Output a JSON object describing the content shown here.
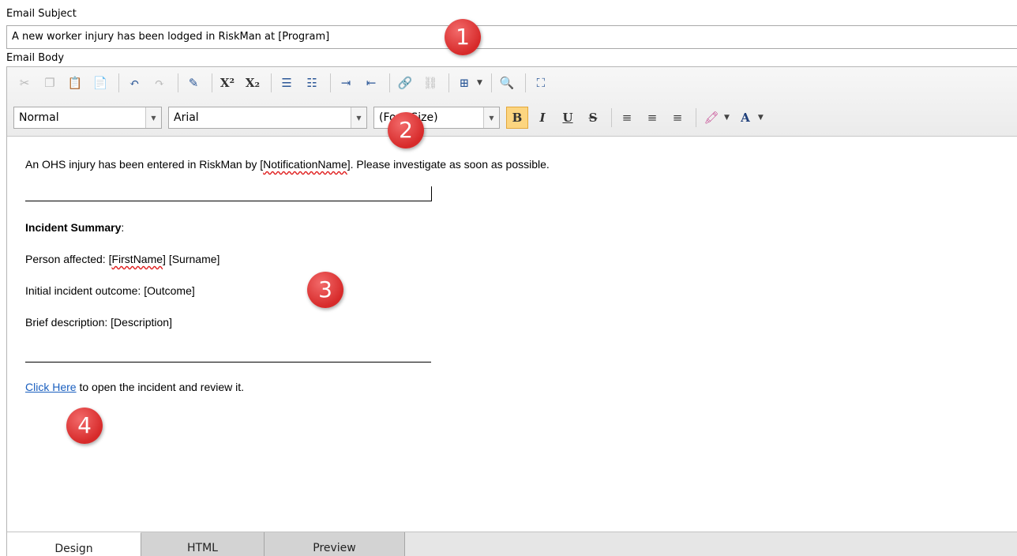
{
  "subject": {
    "label": "Email Subject",
    "value": "A new worker injury has been lodged in RiskMan at [Program]"
  },
  "body": {
    "label": "Email Body"
  },
  "toolbar": {
    "style_value": "Normal",
    "font_value": "Arial",
    "size_value": "(Font Size)",
    "bold_glyph": "B",
    "italic_glyph": "I",
    "underline_glyph": "U",
    "strike_glyph": "S",
    "forecolor_glyph": "A",
    "superscript_glyph": "X²",
    "subscript_glyph": "X₂"
  },
  "content": {
    "intro_prefix": "An OHS injury has been entered in RiskMan by [",
    "intro_field": "NotificationName",
    "intro_suffix": "]. Please investigate as soon as possible.",
    "summary_heading": "Incident Summary",
    "summary_colon": ":",
    "person_prefix": "Person affected: [",
    "person_field": "FirstName",
    "person_suffix": "] [Surname]",
    "outcome_line": "Initial incident outcome: [Outcome]",
    "description_line": "Brief description: [Description]",
    "link_text": "Click Here",
    "link_suffix": " to open the incident and review it."
  },
  "tabs": [
    {
      "label": "Design"
    },
    {
      "label": "HTML"
    },
    {
      "label": "Preview"
    }
  ],
  "badges": [
    "1",
    "2",
    "3",
    "4"
  ],
  "colors": {
    "badge": "#d72a2a",
    "link": "#1a5fbf",
    "bold_active": "#fcd580"
  }
}
